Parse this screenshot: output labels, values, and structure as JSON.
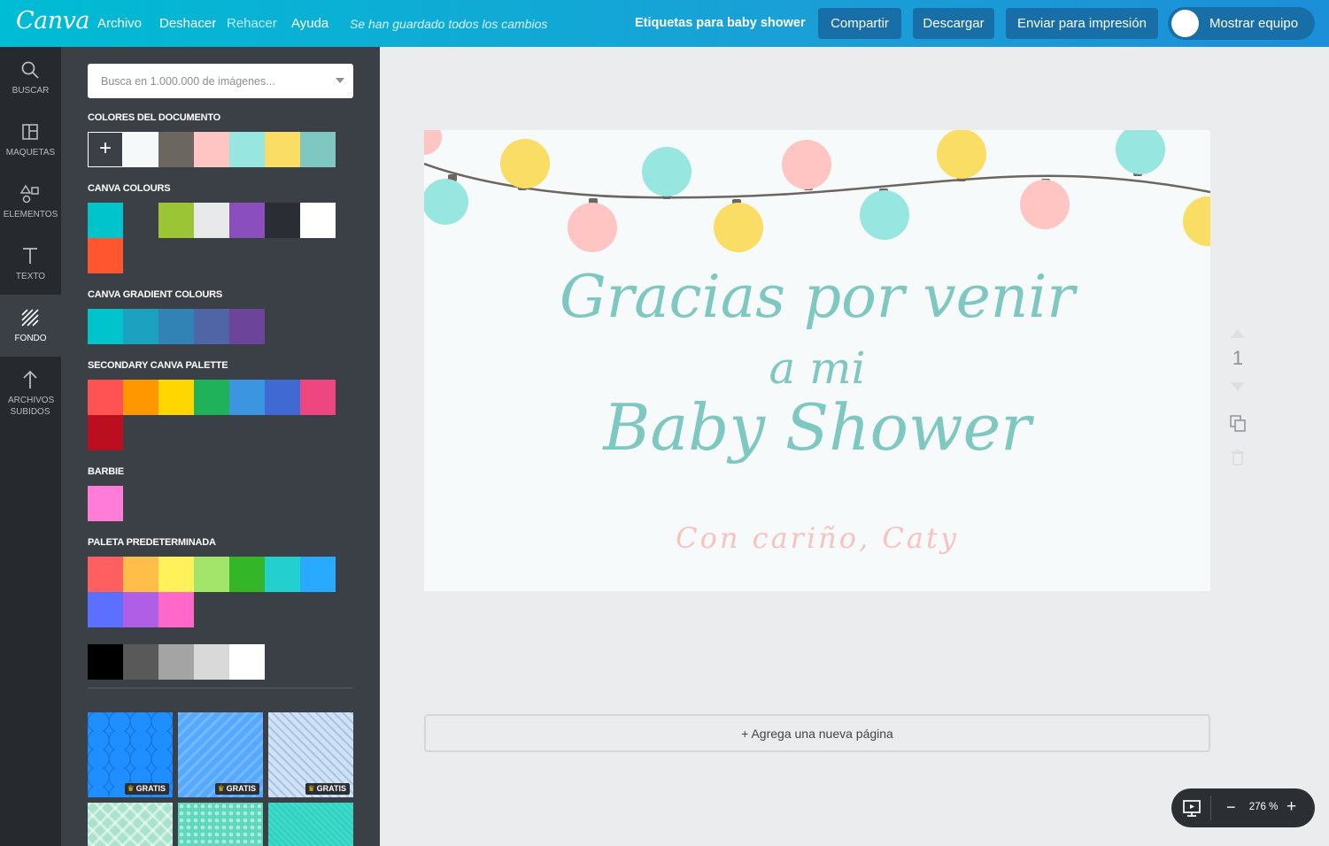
{
  "app": {
    "logo": "Canva"
  },
  "menu": {
    "file": "Archivo",
    "undo": "Deshacer",
    "redo": "Rehacer",
    "help": "Ayuda",
    "saved_status": "Se han guardado todos los cambios"
  },
  "header": {
    "doc_title": "Etiquetas para baby shower",
    "share": "Compartir",
    "download": "Descargar",
    "print": "Enviar para impresión",
    "team": "Mostrar equipo"
  },
  "rail": [
    "BUSCAR",
    "MAQUETAS",
    "ELEMENTOS",
    "TEXTO",
    "FONDO",
    "ARCHIVOS SUBIDOS"
  ],
  "rail_active": "FONDO",
  "search": {
    "placeholder": "Busca en 1.000.000 de imágenes..."
  },
  "palettes": {
    "document": {
      "title": "COLORES DEL DOCUMENTO",
      "add_label": "+",
      "colors": [
        "#f6f9fa",
        "#6b6660",
        "#ffc5c2",
        "#98e6e0",
        "#f9dd64",
        "#7ec8c1"
      ]
    },
    "canva": {
      "title": "CANVA COLOURS",
      "colors": [
        "#00c4cc",
        "#3b3f46",
        "#9bc534",
        "#e8e9eb",
        "#8b4fbd",
        "#2a2d33",
        "#ffffff",
        "#ff5630"
      ]
    },
    "gradient": {
      "title": "CANVA GRADIENT COLOURS",
      "colors": [
        "#00c4cc",
        "#1da1c0",
        "#3283b5",
        "#4f65a5",
        "#6c459a"
      ]
    },
    "secondary": {
      "title": "SECONDARY CANVA PALETTE",
      "colors": [
        "#ff5252",
        "#ff9800",
        "#ffd600",
        "#1fb25a",
        "#3c95e0",
        "#4169d3",
        "#ee4681",
        "#bb0f20"
      ]
    },
    "barbie": {
      "title": "BARBIE",
      "colors": [
        "#ff7cd8"
      ]
    },
    "default": {
      "title": "PALETA PREDETERMINADA",
      "colors": [
        "#ff5f5f",
        "#ffbd4a",
        "#fff15a",
        "#a3e56a",
        "#33b729",
        "#23cfcf",
        "#27aaff",
        "#5c70ff",
        "#b15ee6",
        "#ff67c9"
      ]
    },
    "grays": {
      "colors": [
        "#000000",
        "#595959",
        "#a4a4a4",
        "#d9d9d9",
        "#ffffff"
      ]
    }
  },
  "backgrounds": {
    "badge": "GRATIS",
    "count_badged": 3
  },
  "design": {
    "line1": "Gracias por venir",
    "line2": "a mi",
    "line3": "Baby Shower",
    "signature": "Con cariño, Caty"
  },
  "pager": {
    "page": "1"
  },
  "add_page": "+ Agrega una nueva página",
  "zoom": {
    "value": "276 %",
    "minus": "−",
    "plus": "+"
  }
}
